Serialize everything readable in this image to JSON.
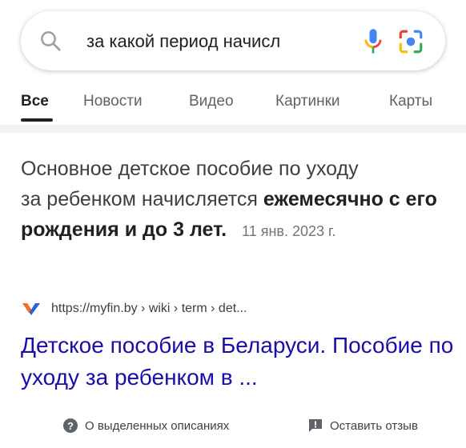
{
  "search": {
    "query": "за какой период начисл"
  },
  "tabs": [
    {
      "label": "Все",
      "active": true
    },
    {
      "label": "Новости",
      "active": false
    },
    {
      "label": "Видео",
      "active": false
    },
    {
      "label": "Картинки",
      "active": false
    },
    {
      "label": "Карты",
      "active": false
    }
  ],
  "featured_snippet": {
    "text_line1": "Основное детское пособие по уходу",
    "text_line2": "за ребенком начисляется",
    "bold_text": "ежемесячно с его рождения и до 3 лет",
    "after_bold": ".",
    "date": "11 янв. 2023 г."
  },
  "source": {
    "breadcrumb": "https://myfin.by › wiki › term › det...",
    "favicon": "myfin-logo-icon"
  },
  "result": {
    "title": "Детское пособие в Беларуси. Пособие по уходу за ребенком в ..."
  },
  "footer": {
    "about_label": "О выделенных описаниях",
    "feedback_label": "Оставить отзыв"
  },
  "colors": {
    "link": "#1a0dab",
    "text": "#202124",
    "muted": "#70757a"
  }
}
